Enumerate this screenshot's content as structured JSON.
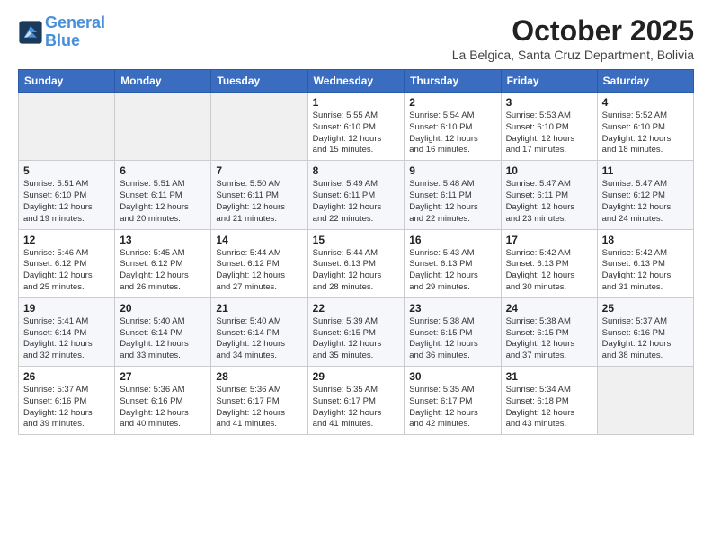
{
  "logo": {
    "line1": "General",
    "line2": "Blue"
  },
  "header": {
    "month": "October 2025",
    "location": "La Belgica, Santa Cruz Department, Bolivia"
  },
  "weekdays": [
    "Sunday",
    "Monday",
    "Tuesday",
    "Wednesday",
    "Thursday",
    "Friday",
    "Saturday"
  ],
  "weeks": [
    [
      {
        "day": "",
        "info": ""
      },
      {
        "day": "",
        "info": ""
      },
      {
        "day": "",
        "info": ""
      },
      {
        "day": "1",
        "info": "Sunrise: 5:55 AM\nSunset: 6:10 PM\nDaylight: 12 hours\nand 15 minutes."
      },
      {
        "day": "2",
        "info": "Sunrise: 5:54 AM\nSunset: 6:10 PM\nDaylight: 12 hours\nand 16 minutes."
      },
      {
        "day": "3",
        "info": "Sunrise: 5:53 AM\nSunset: 6:10 PM\nDaylight: 12 hours\nand 17 minutes."
      },
      {
        "day": "4",
        "info": "Sunrise: 5:52 AM\nSunset: 6:10 PM\nDaylight: 12 hours\nand 18 minutes."
      }
    ],
    [
      {
        "day": "5",
        "info": "Sunrise: 5:51 AM\nSunset: 6:10 PM\nDaylight: 12 hours\nand 19 minutes."
      },
      {
        "day": "6",
        "info": "Sunrise: 5:51 AM\nSunset: 6:11 PM\nDaylight: 12 hours\nand 20 minutes."
      },
      {
        "day": "7",
        "info": "Sunrise: 5:50 AM\nSunset: 6:11 PM\nDaylight: 12 hours\nand 21 minutes."
      },
      {
        "day": "8",
        "info": "Sunrise: 5:49 AM\nSunset: 6:11 PM\nDaylight: 12 hours\nand 22 minutes."
      },
      {
        "day": "9",
        "info": "Sunrise: 5:48 AM\nSunset: 6:11 PM\nDaylight: 12 hours\nand 22 minutes."
      },
      {
        "day": "10",
        "info": "Sunrise: 5:47 AM\nSunset: 6:11 PM\nDaylight: 12 hours\nand 23 minutes."
      },
      {
        "day": "11",
        "info": "Sunrise: 5:47 AM\nSunset: 6:12 PM\nDaylight: 12 hours\nand 24 minutes."
      }
    ],
    [
      {
        "day": "12",
        "info": "Sunrise: 5:46 AM\nSunset: 6:12 PM\nDaylight: 12 hours\nand 25 minutes."
      },
      {
        "day": "13",
        "info": "Sunrise: 5:45 AM\nSunset: 6:12 PM\nDaylight: 12 hours\nand 26 minutes."
      },
      {
        "day": "14",
        "info": "Sunrise: 5:44 AM\nSunset: 6:12 PM\nDaylight: 12 hours\nand 27 minutes."
      },
      {
        "day": "15",
        "info": "Sunrise: 5:44 AM\nSunset: 6:13 PM\nDaylight: 12 hours\nand 28 minutes."
      },
      {
        "day": "16",
        "info": "Sunrise: 5:43 AM\nSunset: 6:13 PM\nDaylight: 12 hours\nand 29 minutes."
      },
      {
        "day": "17",
        "info": "Sunrise: 5:42 AM\nSunset: 6:13 PM\nDaylight: 12 hours\nand 30 minutes."
      },
      {
        "day": "18",
        "info": "Sunrise: 5:42 AM\nSunset: 6:13 PM\nDaylight: 12 hours\nand 31 minutes."
      }
    ],
    [
      {
        "day": "19",
        "info": "Sunrise: 5:41 AM\nSunset: 6:14 PM\nDaylight: 12 hours\nand 32 minutes."
      },
      {
        "day": "20",
        "info": "Sunrise: 5:40 AM\nSunset: 6:14 PM\nDaylight: 12 hours\nand 33 minutes."
      },
      {
        "day": "21",
        "info": "Sunrise: 5:40 AM\nSunset: 6:14 PM\nDaylight: 12 hours\nand 34 minutes."
      },
      {
        "day": "22",
        "info": "Sunrise: 5:39 AM\nSunset: 6:15 PM\nDaylight: 12 hours\nand 35 minutes."
      },
      {
        "day": "23",
        "info": "Sunrise: 5:38 AM\nSunset: 6:15 PM\nDaylight: 12 hours\nand 36 minutes."
      },
      {
        "day": "24",
        "info": "Sunrise: 5:38 AM\nSunset: 6:15 PM\nDaylight: 12 hours\nand 37 minutes."
      },
      {
        "day": "25",
        "info": "Sunrise: 5:37 AM\nSunset: 6:16 PM\nDaylight: 12 hours\nand 38 minutes."
      }
    ],
    [
      {
        "day": "26",
        "info": "Sunrise: 5:37 AM\nSunset: 6:16 PM\nDaylight: 12 hours\nand 39 minutes."
      },
      {
        "day": "27",
        "info": "Sunrise: 5:36 AM\nSunset: 6:16 PM\nDaylight: 12 hours\nand 40 minutes."
      },
      {
        "day": "28",
        "info": "Sunrise: 5:36 AM\nSunset: 6:17 PM\nDaylight: 12 hours\nand 41 minutes."
      },
      {
        "day": "29",
        "info": "Sunrise: 5:35 AM\nSunset: 6:17 PM\nDaylight: 12 hours\nand 41 minutes."
      },
      {
        "day": "30",
        "info": "Sunrise: 5:35 AM\nSunset: 6:17 PM\nDaylight: 12 hours\nand 42 minutes."
      },
      {
        "day": "31",
        "info": "Sunrise: 5:34 AM\nSunset: 6:18 PM\nDaylight: 12 hours\nand 43 minutes."
      },
      {
        "day": "",
        "info": ""
      }
    ]
  ]
}
